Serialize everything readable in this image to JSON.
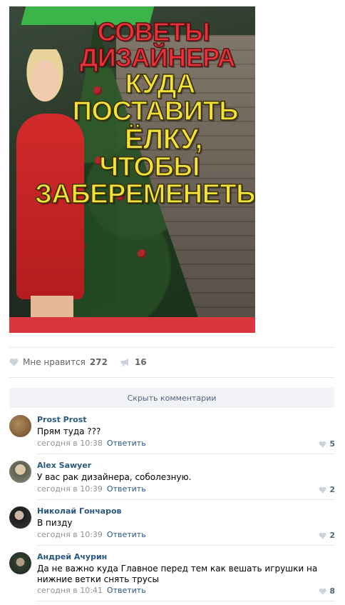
{
  "post": {
    "image": {
      "banner_lines": [
        "СОВЕТЫ",
        "ДИЗАЙНЕРА",
        "КУДА",
        "ПОСТАВИТЬ",
        "ЁЛКУ,",
        "ЧТОБЫ",
        "ЗАБЕРЕМЕНЕТЬ"
      ]
    },
    "actions": {
      "like_label": "Мне нравится",
      "like_count": "272",
      "share_count": "16"
    }
  },
  "comments_toggle": "Скрыть комментарии",
  "reply_label": "Ответить",
  "comments": [
    {
      "author": "Prost Prost",
      "text": "Прям туда ???",
      "time": "сегодня в 10:38",
      "likes": "5",
      "avatar_color": "#8a6a4a"
    },
    {
      "author": "Alex Sawyer",
      "text": "У вас рак дизайнера, соболезную.",
      "time": "сегодня в 10:39",
      "likes": "2",
      "avatar_color": "#7a8070"
    },
    {
      "author": "Николай Гончаров",
      "text": "В пизду",
      "time": "сегодня в 10:39",
      "likes": "2",
      "avatar_color": "#2b2b2b"
    },
    {
      "author": "Андрей Ачурин",
      "text": "Да не важно куда Главное перед тем как вешать игрушки на нижние ветки снять трусы",
      "time": "сегодня в 10:41",
      "likes": "8",
      "avatar_color": "#3a4a3a"
    }
  ],
  "colors": {
    "link": "#2a5885",
    "meta": "#939393",
    "toggle_bg": "#f0f2f5",
    "like_icon": "#cbd3dd"
  }
}
